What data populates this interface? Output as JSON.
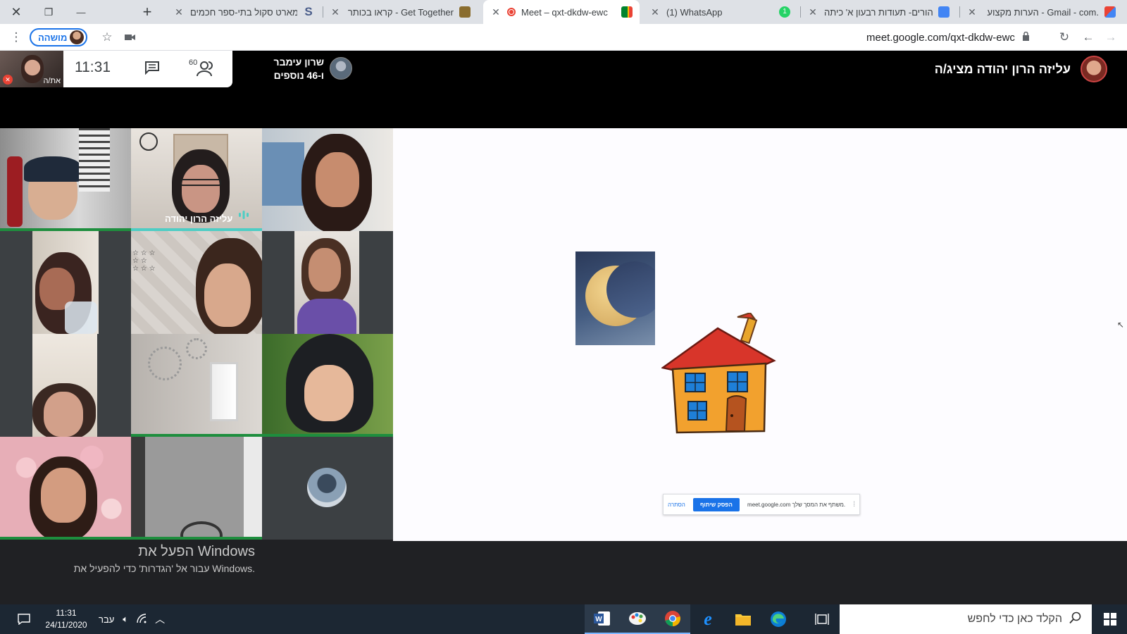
{
  "browser": {
    "tabs": [
      {
        "title": "הערות מקצוע - Gmail - com.",
        "favicon_color": "#ea4335",
        "icon": "gmail-icon"
      },
      {
        "title": "יום הורים- תעודות רבעון א' כיתה",
        "favicon_color": "#4285f4",
        "icon": "docs-icon"
      },
      {
        "title": "(1) WhatsApp",
        "favicon_color": "#25d366",
        "icon": "whatsapp-icon",
        "badge": "1"
      },
      {
        "title": "Meet – qxt-dkdw-ewc",
        "favicon_color": "#00832d",
        "icon": "meet-icon",
        "active": true
      },
      {
        "title": "קראו בכותר - Get Together",
        "favicon_color": "#8a6d2e",
        "icon": "kotar-icon"
      },
      {
        "title": "סמארט סקול בתי-ספר חכמים",
        "favicon_color": "#4a5d8a",
        "icon": "smartschool-icon"
      }
    ],
    "new_tab_symbol": "+",
    "window_controls": {
      "close": "✕",
      "restore": "❐",
      "minimize": "—"
    },
    "url": "meet.google.com/qxt-dkdw-ewc",
    "profile_name": "מושהה"
  },
  "meet": {
    "clock": "11:31",
    "people_count": "60",
    "you_label": "את/ה",
    "participant_card": {
      "name": "שרון עימבר",
      "more": "ו-46 נוספים"
    },
    "presenter_text": "עליזה הרון יהודה מציג/ה",
    "speaker_tile_name": "עליזה הרון יהודה",
    "share_bar": {
      "message": "meet.google.com משתף את המסך שלך.",
      "stop_button": "הפסק שיתוף",
      "hide_button": "הסתרה"
    },
    "activate_windows": {
      "title": "הפעל את Windows",
      "subtitle": "עבור אל 'הגדרות' כדי להפעיל את Windows."
    }
  },
  "taskbar": {
    "search_placeholder": "הקלד כאן כדי לחפש",
    "time": "11:31",
    "date": "24/11/2020",
    "language": "עבר",
    "apps": [
      "word-icon",
      "paint-icon",
      "chrome-icon",
      "ie-icon",
      "explorer-icon",
      "edge-icon",
      "task-view-icon"
    ]
  },
  "colors": {
    "accent": "#1a73e8",
    "speaking": "#4ecdc4",
    "tile_active": "#1e8e3e",
    "taskbar": "#1c2733"
  }
}
